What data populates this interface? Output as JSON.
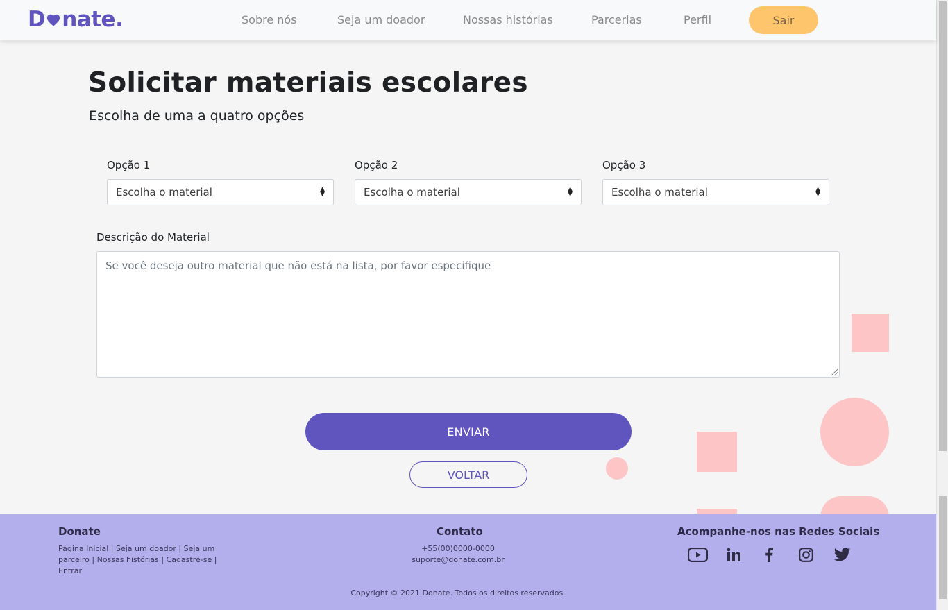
{
  "brand": {
    "logo": "Donate.",
    "color": "#6055bf"
  },
  "nav": {
    "items": [
      "Sobre nós",
      "Seja um doador",
      "Nossas histórias",
      "Parcerias",
      "Perfil"
    ],
    "logout": "Sair"
  },
  "main": {
    "title": "Solicitar materiais escolares",
    "subtitle": "Escolha de uma a quatro opções",
    "options": [
      {
        "label": "Opção 1",
        "value": "Escolha o material"
      },
      {
        "label": "Opção 2",
        "value": "Escolha o material"
      },
      {
        "label": "Opção 3",
        "value": "Escolha o material"
      }
    ],
    "description": {
      "label": "Descrição do Material",
      "placeholder": "Se você deseja outro material que não está na lista, por favor especifique"
    },
    "submit": "ENVIAR",
    "back": "VOLTAR"
  },
  "footer": {
    "donate": {
      "title": "Donate",
      "links": "Página Inicial | Seja um doador | Seja um parceiro | Nossas histórias | Cadastre-se | Entrar"
    },
    "contact": {
      "title": "Contato",
      "phone": "+55(00)0000-0000",
      "email": "suporte@donate.com.br"
    },
    "social": {
      "title": "Acompanhe-nos nas Redes Sociais",
      "icons": [
        "youtube-icon",
        "linkedin-icon",
        "facebook-icon",
        "instagram-icon",
        "twitter-icon"
      ]
    },
    "copyright": "Copyright © 2021 Donate. Todos os direitos reservados."
  },
  "colors": {
    "accent": "#6055bf",
    "logout": "#ffc56c",
    "footer": "#b3aeec",
    "decor": "#fec5c6"
  }
}
